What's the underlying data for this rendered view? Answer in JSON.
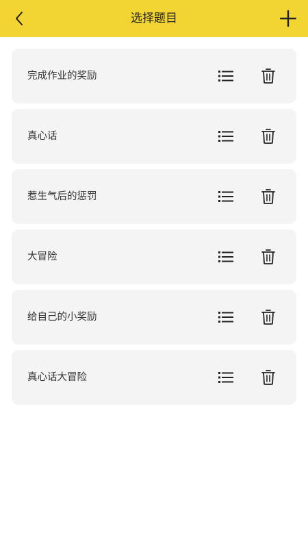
{
  "header": {
    "title": "选择题目",
    "background_color": "#f2d432",
    "back_icon": "chevron-left-icon",
    "add_icon": "plus-icon"
  },
  "topics": [
    {
      "label": "完成作业的奖励"
    },
    {
      "label": "真心话"
    },
    {
      "label": "惹生气后的惩罚"
    },
    {
      "label": "大冒险"
    },
    {
      "label": "给自己的小奖励"
    },
    {
      "label": "真心话大冒险"
    }
  ],
  "row_icons": {
    "list": "list-icon",
    "delete": "trash-icon"
  }
}
